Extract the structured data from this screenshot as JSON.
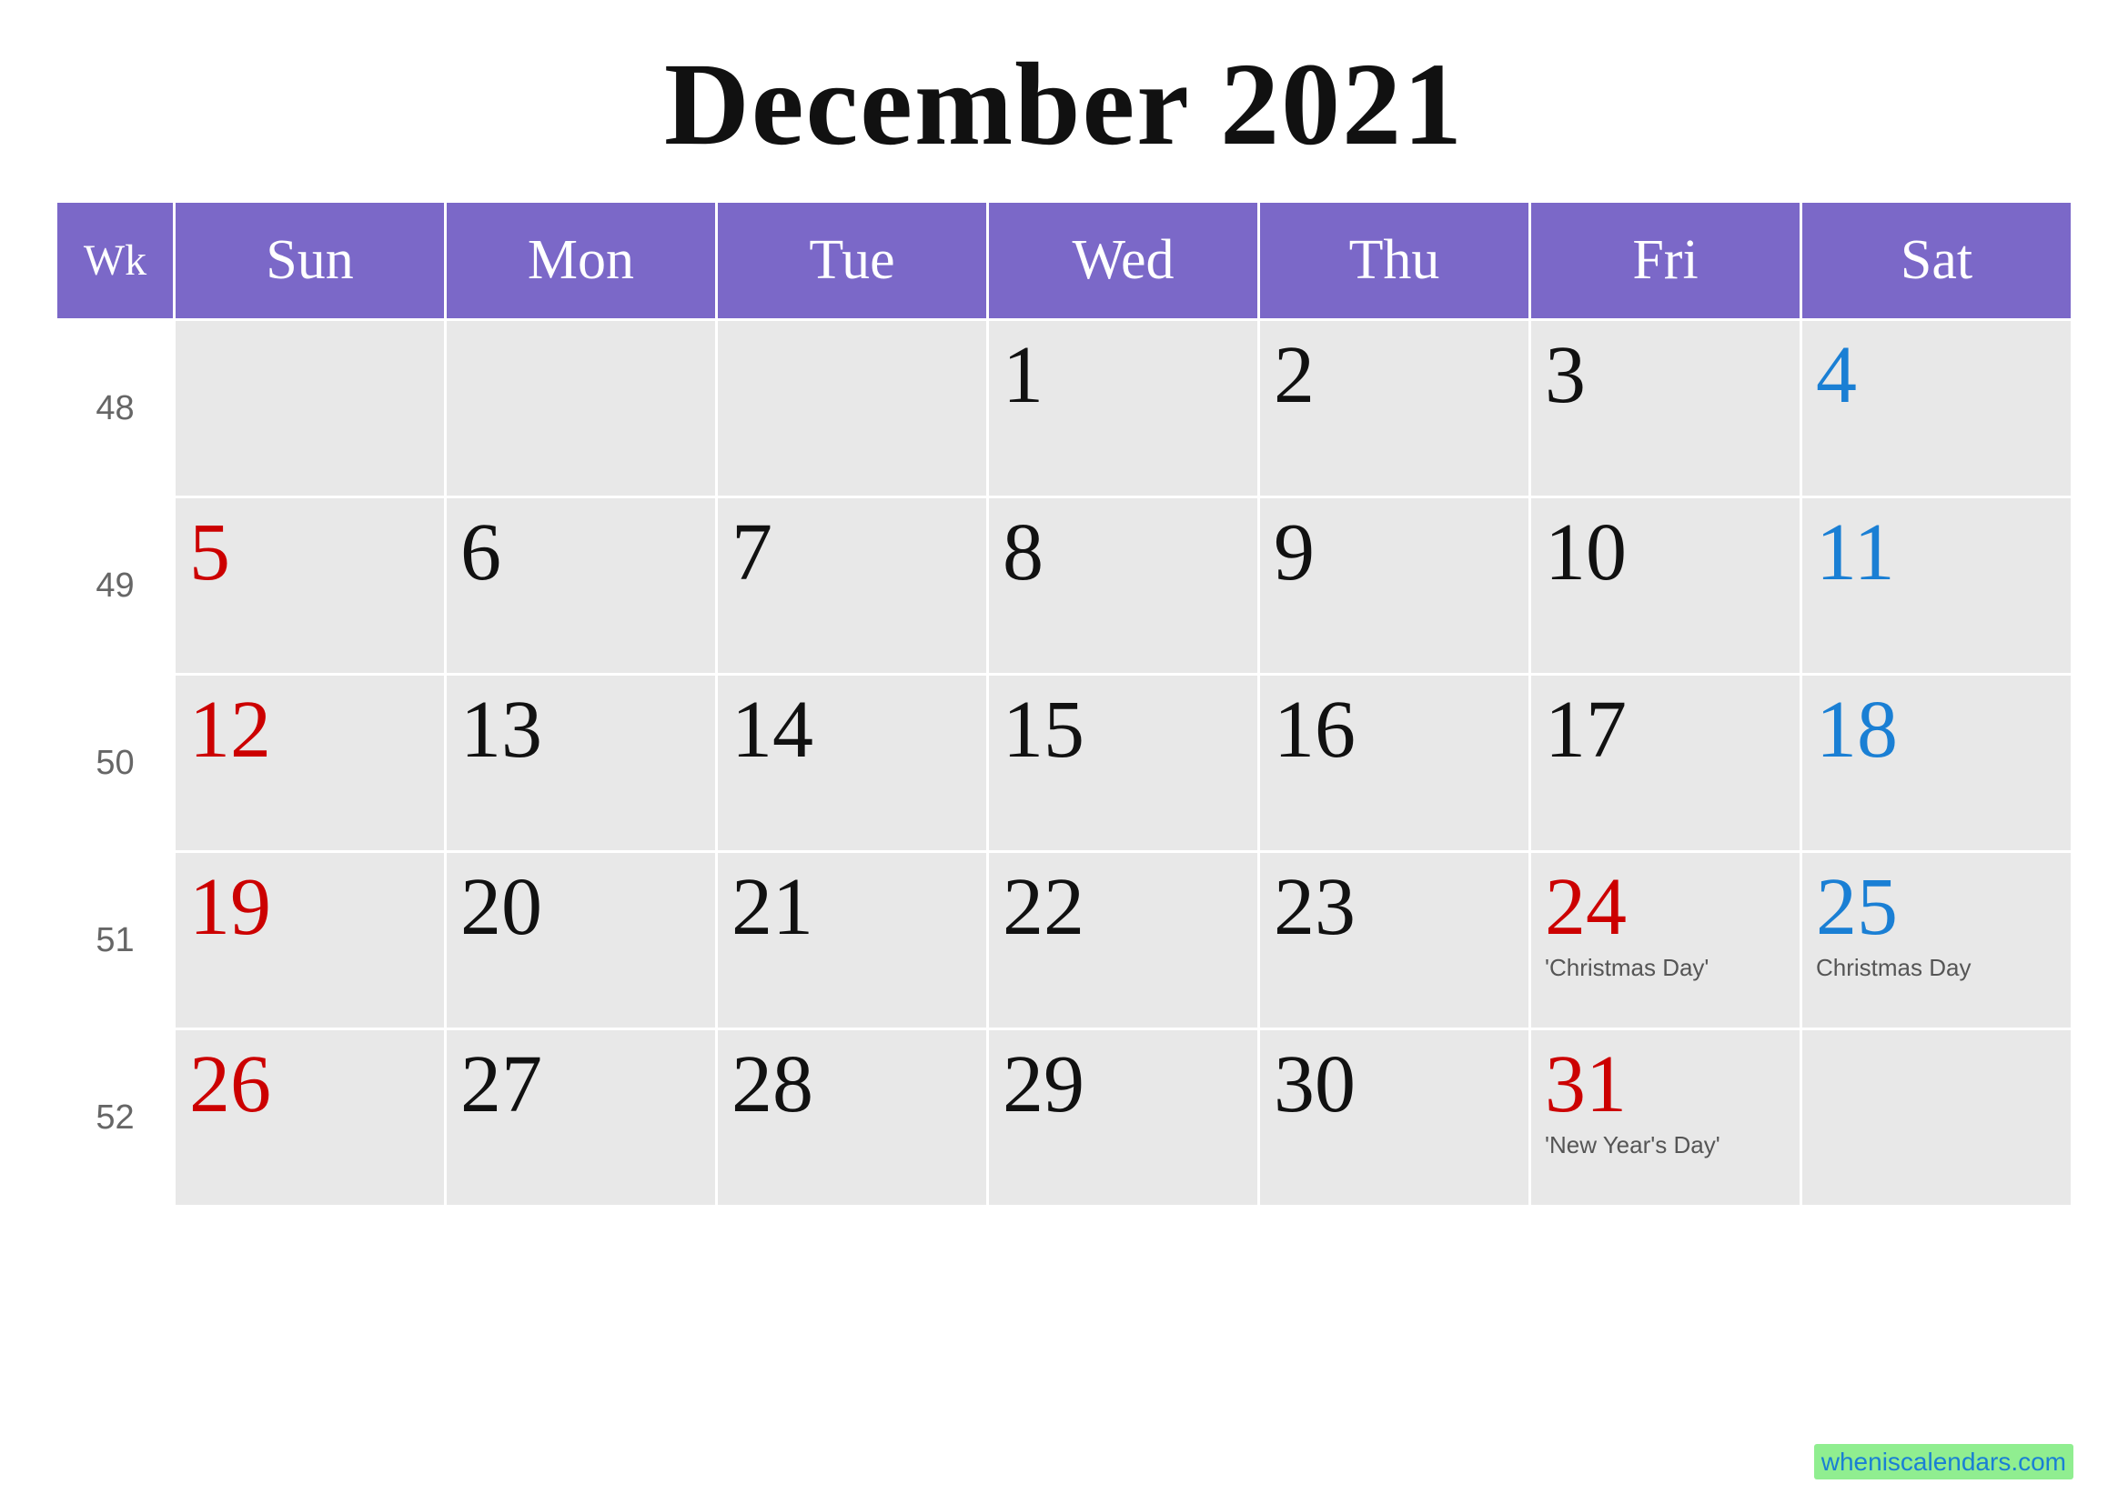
{
  "title": "December 2021",
  "header": {
    "columns": [
      {
        "label": "Wk",
        "key": "wk"
      },
      {
        "label": "Sun",
        "key": "sun"
      },
      {
        "label": "Mon",
        "key": "mon"
      },
      {
        "label": "Tue",
        "key": "tue"
      },
      {
        "label": "Wed",
        "key": "wed"
      },
      {
        "label": "Thu",
        "key": "thu"
      },
      {
        "label": "Fri",
        "key": "fri"
      },
      {
        "label": "Sat",
        "key": "sat"
      }
    ]
  },
  "weeks": [
    {
      "wk": "48",
      "days": [
        {
          "date": "",
          "type": "empty"
        },
        {
          "date": "",
          "type": "empty"
        },
        {
          "date": "",
          "type": "empty"
        },
        {
          "date": "1",
          "type": "normal"
        },
        {
          "date": "2",
          "type": "normal"
        },
        {
          "date": "3",
          "type": "normal"
        },
        {
          "date": "4",
          "type": "saturday"
        }
      ]
    },
    {
      "wk": "49",
      "days": [
        {
          "date": "5",
          "type": "sunday"
        },
        {
          "date": "6",
          "type": "normal"
        },
        {
          "date": "7",
          "type": "normal"
        },
        {
          "date": "8",
          "type": "normal"
        },
        {
          "date": "9",
          "type": "normal"
        },
        {
          "date": "10",
          "type": "normal"
        },
        {
          "date": "11",
          "type": "saturday"
        }
      ]
    },
    {
      "wk": "50",
      "days": [
        {
          "date": "12",
          "type": "sunday"
        },
        {
          "date": "13",
          "type": "normal"
        },
        {
          "date": "14",
          "type": "normal"
        },
        {
          "date": "15",
          "type": "normal"
        },
        {
          "date": "16",
          "type": "normal"
        },
        {
          "date": "17",
          "type": "normal"
        },
        {
          "date": "18",
          "type": "saturday"
        }
      ]
    },
    {
      "wk": "51",
      "days": [
        {
          "date": "19",
          "type": "sunday"
        },
        {
          "date": "20",
          "type": "normal"
        },
        {
          "date": "21",
          "type": "normal"
        },
        {
          "date": "22",
          "type": "normal"
        },
        {
          "date": "23",
          "type": "normal"
        },
        {
          "date": "24",
          "type": "holiday",
          "holiday": "'Christmas Day'"
        },
        {
          "date": "25",
          "type": "saturday-holiday",
          "holiday": "Christmas Day"
        }
      ]
    },
    {
      "wk": "52",
      "days": [
        {
          "date": "26",
          "type": "sunday"
        },
        {
          "date": "27",
          "type": "normal"
        },
        {
          "date": "28",
          "type": "normal"
        },
        {
          "date": "29",
          "type": "normal"
        },
        {
          "date": "30",
          "type": "normal"
        },
        {
          "date": "31",
          "type": "holiday",
          "holiday": "'New Year's Day'"
        },
        {
          "date": "",
          "type": "empty"
        }
      ]
    }
  ],
  "watermark": {
    "text": "wheniscalendars.com",
    "url": "#"
  }
}
